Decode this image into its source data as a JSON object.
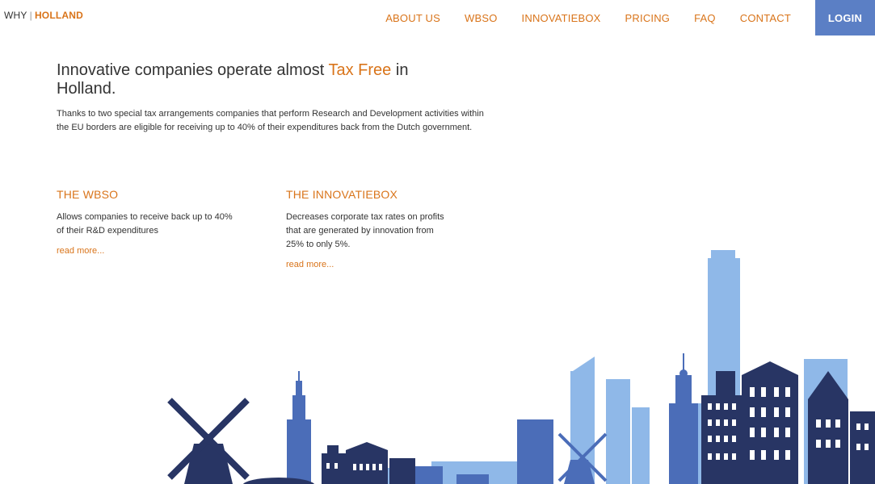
{
  "header": {
    "logo_prefix": "WHY",
    "logo_separator": "|",
    "logo_brand": "HOLLAND",
    "nav": [
      "ABOUT US",
      "WBSO",
      "INNOVATIEBOX",
      "PRICING",
      "FAQ",
      "CONTACT"
    ],
    "login_label": "LOGIN"
  },
  "hero": {
    "title_part1": "Innovative companies operate almost ",
    "title_accent": "Tax Free",
    "title_part2": " in Holland.",
    "description": "Thanks to two special tax arrangements companies that perform Research and Development activities within the EU borders are eligible for receiving up to 40% of their expenditures back from the Dutch government."
  },
  "sections": {
    "wbso": {
      "title": "THE WBSO",
      "text": "Allows companies to receive back up to 40% of their R&D expenditures",
      "link": "read more..."
    },
    "innovatiebox": {
      "title": "THE INNOVATIEBOX",
      "text": "Decreases corporate tax rates on profits that are generated by innovation from 25% to only 5%.",
      "link": "read more..."
    }
  },
  "colors": {
    "accent": "#d9741a",
    "login_bg": "#5b7fc5",
    "navy": "#283564",
    "mid_blue": "#4b6db8",
    "light_blue": "#8fb8e8"
  }
}
